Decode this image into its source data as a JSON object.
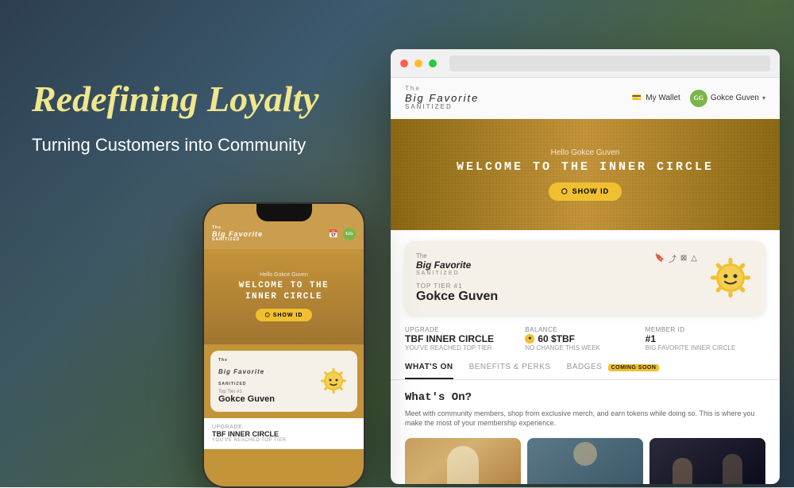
{
  "page": {
    "title": "Redefining Loyalty"
  },
  "hero": {
    "headline": "Redefining Loyalty",
    "subheadline": "Turning Customers into Community"
  },
  "website": {
    "logo_line1": "The",
    "logo_line2": "Big Favorite",
    "logo_sub": "SANITIZED",
    "nav": {
      "wallet_label": "My Wallet",
      "user_initials": "GG",
      "user_name": "Gokce Guven"
    },
    "hero": {
      "greeting": "Hello Gokce Guven",
      "title_line1": "WELCOME TO THE INNER",
      "title_line2": "CIRCLE",
      "show_id_label": "SHOW ID"
    },
    "membership_card": {
      "tier_badge": "Top Tier #1",
      "user_name": "Gokce Guven"
    },
    "stats": {
      "upgrade_label": "Upgrade",
      "upgrade_value": "TBF INNER CIRCLE",
      "upgrade_sub": "YOU'VE REACHED TOP TIER",
      "balance_label": "Balance",
      "balance_value": "60 $TBF",
      "balance_sub": "NO CHANGE THIS WEEK",
      "member_label": "Member ID",
      "member_value": "#1",
      "member_sub": "BIG FAVORITE INNER CIRCLE"
    },
    "tabs": [
      {
        "label": "WHAT'S ON",
        "active": true
      },
      {
        "label": "BENEFITS & PERKS",
        "active": false
      },
      {
        "label": "BADGES",
        "active": false
      },
      {
        "label": "COMING SOON",
        "badge": true,
        "active": false
      }
    ],
    "whats_on": {
      "title": "What's On?",
      "description": "Meet with community members, shop from exclusive merch, and earn tokens while doing so. This is where you make the most of your membership experience."
    }
  },
  "phone": {
    "logo_line1": "The",
    "logo_line2": "Big Favorite",
    "logo_sub": "SANITIZED",
    "user_initials": "GG",
    "hero": {
      "greeting": "Hello Gokce Guven",
      "title": "WELCOME TO THE\nINNER CIRCLE",
      "show_id_label": "SHOW ID"
    },
    "card": {
      "tier": "Top Tier #1",
      "name": "Gokce Guven"
    },
    "upgrade": {
      "label": "Upgrade",
      "value": "TBF INNER CIRCLE",
      "sub": "YOU'VE REACHED TOP TIER"
    }
  },
  "icons": {
    "show_id": "⬡",
    "wallet": "💳",
    "coin": "●"
  }
}
